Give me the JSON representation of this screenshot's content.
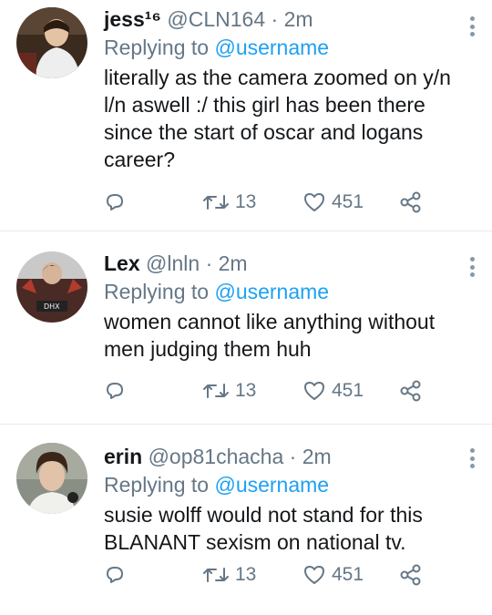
{
  "tweets": [
    {
      "display_name": "jess¹⁶",
      "handle": "@CLN164",
      "separator": "·",
      "time": "2m",
      "reply_prefix": "Replying to",
      "reply_to": "@username",
      "text": "literally as the camera zoomed on y/n l/n aswell :/ this girl has been there since the start of oscar and logans career?",
      "retweets": "13",
      "likes": "451"
    },
    {
      "display_name": "Lex",
      "handle": "@lnln",
      "separator": "·",
      "time": "2m",
      "reply_prefix": "Replying to",
      "reply_to": "@username",
      "text": "women cannot like anything without men judging them huh",
      "retweets": "13",
      "likes": "451"
    },
    {
      "display_name": "erin",
      "handle": "@op81chacha",
      "separator": "·",
      "time": "2m",
      "reply_prefix": "Replying to",
      "reply_to": "@username",
      "text": "susie wolff would not stand for this BLANANT sexism on national tv.",
      "retweets": "13",
      "likes": "451"
    }
  ],
  "icons": {
    "reply": "reply-icon",
    "retweet": "retweet-icon",
    "like": "heart-icon",
    "share": "share-icon",
    "more": "more-options-icon"
  },
  "colors": {
    "link": "#1da1f2",
    "muted": "#657786",
    "text": "#14171a",
    "divider": "#e6ecf0"
  }
}
